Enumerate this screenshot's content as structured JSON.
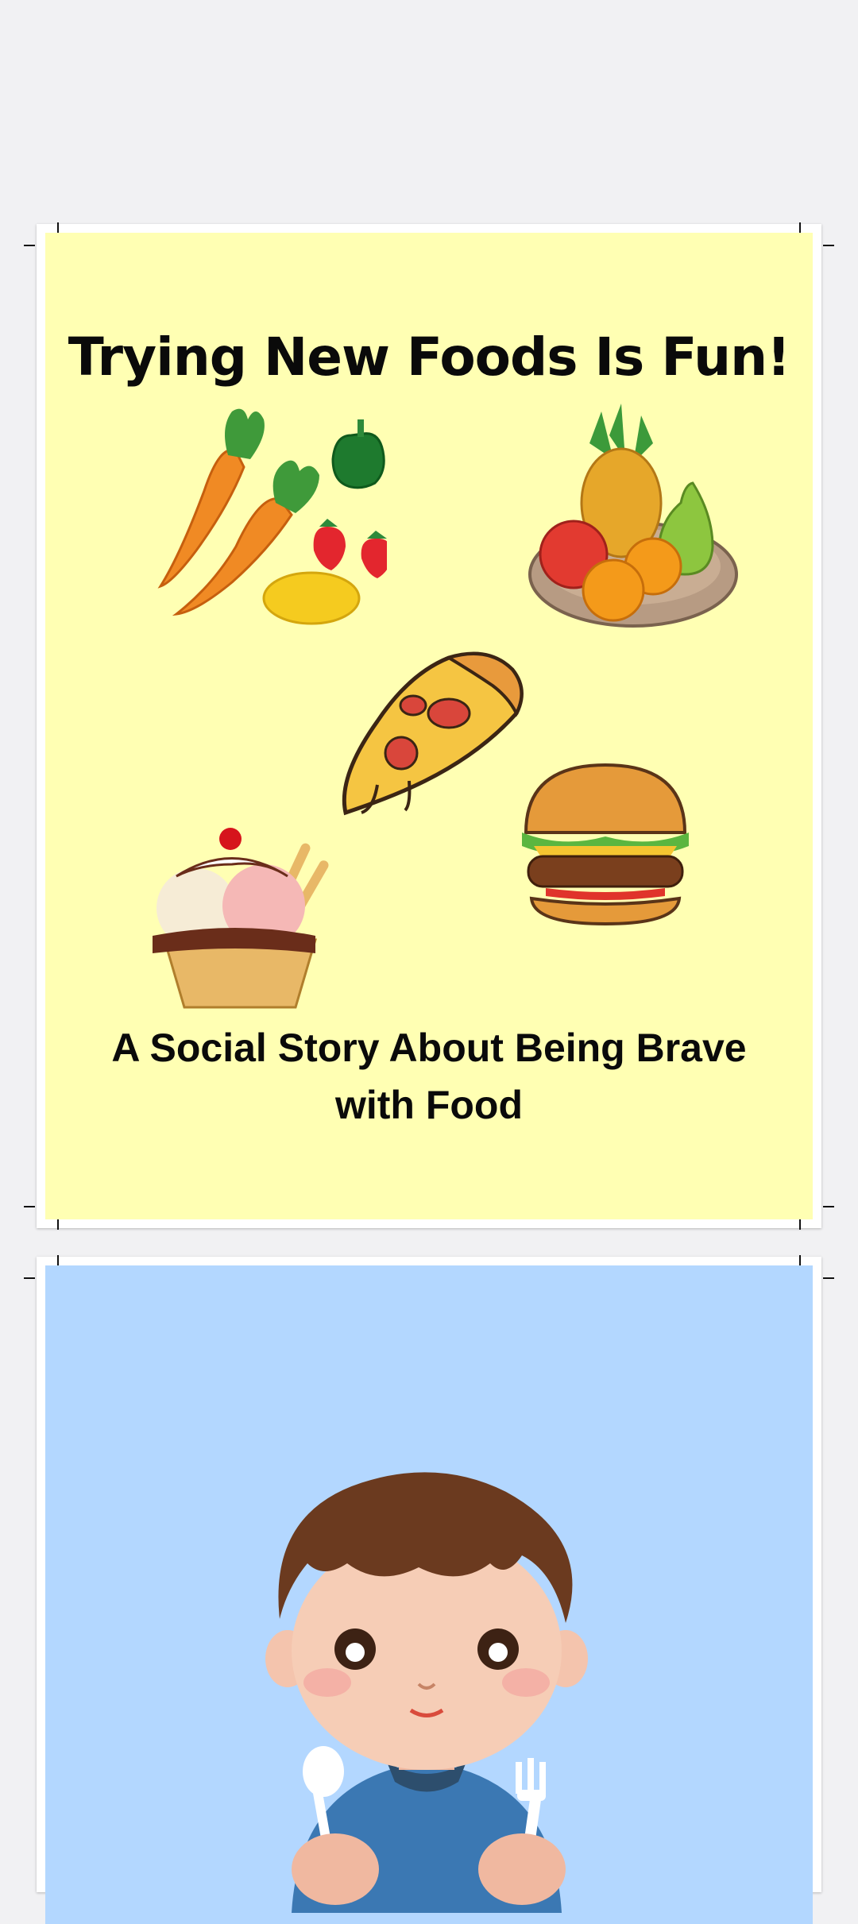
{
  "pages": [
    {
      "title": "Trying New Foods Is Fun!",
      "subtitle": "A Social Story About Being Brave with Food",
      "background": "#ffffb3",
      "illustrations": [
        "vegetables-illustration",
        "fruit-bowl-illustration",
        "pizza-slice-illustration",
        "ice-cream-illustration",
        "hamburger-illustration"
      ]
    },
    {
      "background": "#b3d7ff",
      "illustrations": [
        "child-with-utensils-illustration"
      ]
    }
  ]
}
